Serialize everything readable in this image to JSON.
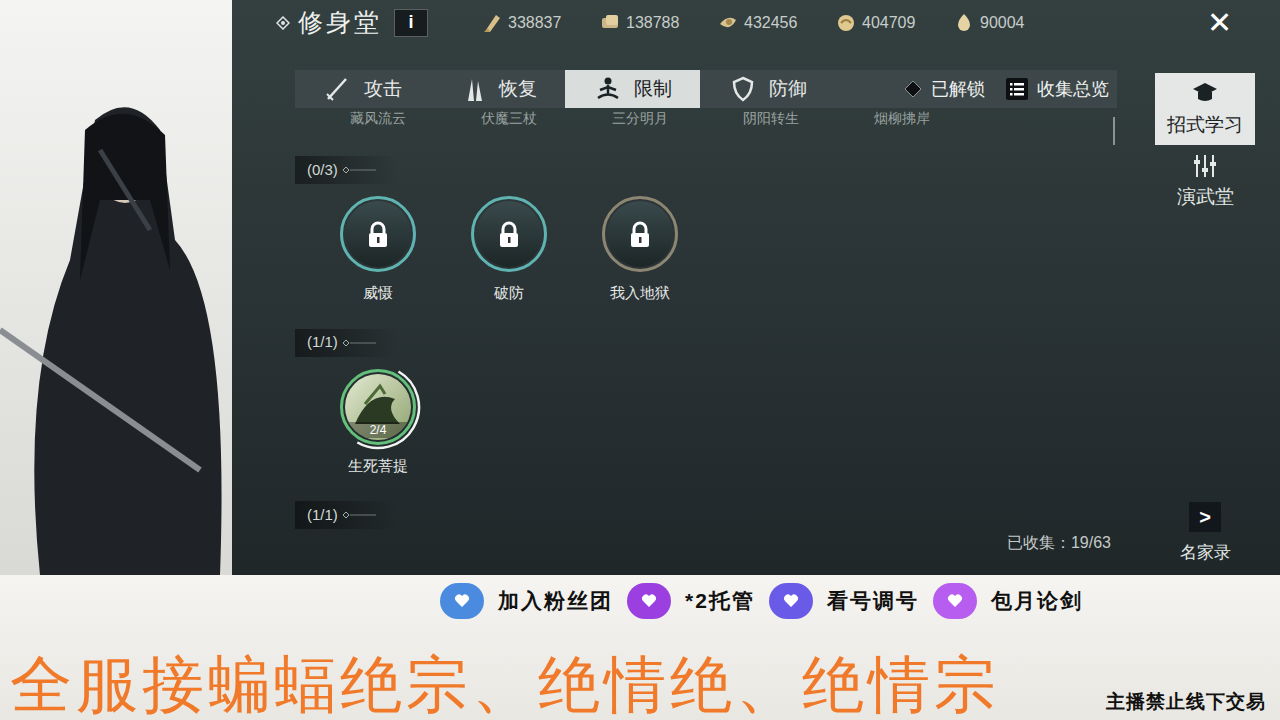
{
  "title": "修身堂",
  "info_button": "i",
  "currencies": [
    {
      "value": "338837"
    },
    {
      "value": "138788"
    },
    {
      "value": "432456"
    },
    {
      "value": "404709"
    },
    {
      "value": "90004"
    }
  ],
  "close": "✕",
  "tabs": [
    {
      "label": "攻击",
      "selected": false
    },
    {
      "label": "恢复",
      "selected": false
    },
    {
      "label": "限制",
      "selected": true
    },
    {
      "label": "防御",
      "selected": false
    }
  ],
  "filters": [
    {
      "label": "已解锁"
    },
    {
      "label": "收集总览"
    }
  ],
  "cut_row": [
    "藏风流云",
    "伏魔三杖",
    "三分明月",
    "阴阳转生",
    "烟柳拂岸"
  ],
  "groups": [
    {
      "count": "(0/3)",
      "skills": [
        {
          "name": "威慑",
          "kind": "locked",
          "color": "#5fb4b2"
        },
        {
          "name": "破防",
          "kind": "locked",
          "color": "#5fb4b2"
        },
        {
          "name": "我入地狱",
          "kind": "locked",
          "color": "#8c8672"
        }
      ]
    },
    {
      "count": "(1/1)",
      "skills": [
        {
          "name": "生死菩提",
          "kind": "unlocked",
          "color": "#62c07a",
          "progress": "2/4",
          "level": 0.5
        }
      ]
    },
    {
      "count": "(1/1)",
      "skills": []
    }
  ],
  "collected": "已收集：19/63",
  "side_nav": [
    {
      "label": "招式学习",
      "selected": true
    },
    {
      "label": "演武堂",
      "selected": false
    }
  ],
  "next_button": ">",
  "famous": "名家录",
  "overlay": {
    "buttons": [
      {
        "label": "加入粉丝团",
        "color": "#4a8be0"
      },
      {
        "label": "*2托管",
        "color": "#9b3fe0"
      },
      {
        "label": "看号调号",
        "color": "#6a5ae8"
      },
      {
        "label": "包月论剑",
        "color": "#b75ef0"
      }
    ],
    "banner": "全服接蝙蝠绝宗、绝情绝、绝情宗",
    "notice": "主播禁止线下交易"
  }
}
